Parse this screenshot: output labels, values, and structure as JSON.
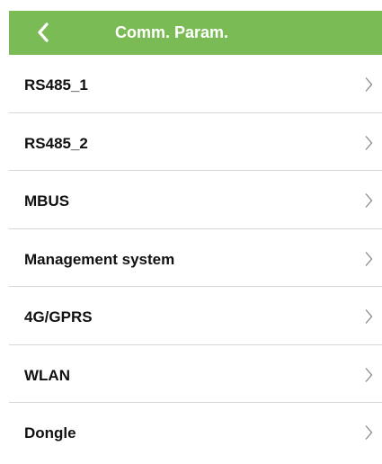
{
  "header": {
    "title": "Comm. Param.",
    "back_icon": "chevron-left-icon",
    "background_color": "#7bbb55",
    "title_color": "#ffffff"
  },
  "menu": {
    "items": [
      {
        "label": "RS485_1",
        "icon": "chevron-right-icon"
      },
      {
        "label": "RS485_2",
        "icon": "chevron-right-icon"
      },
      {
        "label": "MBUS",
        "icon": "chevron-right-icon"
      },
      {
        "label": "Management system",
        "icon": "chevron-right-icon"
      },
      {
        "label": "4G/GPRS",
        "icon": "chevron-right-icon"
      },
      {
        "label": "WLAN",
        "icon": "chevron-right-icon"
      },
      {
        "label": "Dongle",
        "icon": "chevron-right-icon"
      }
    ]
  }
}
